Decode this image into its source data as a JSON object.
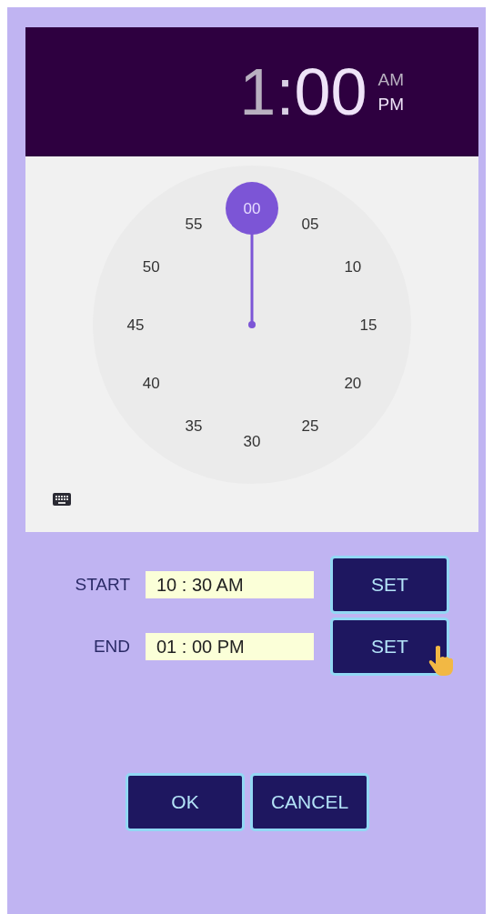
{
  "header": {
    "hour": {
      "text": "1",
      "selected": false
    },
    "separator": ":",
    "minute": {
      "text": "00",
      "selected": true
    },
    "periods": [
      {
        "label": "AM",
        "selected": false
      },
      {
        "label": "PM",
        "selected": true
      }
    ]
  },
  "dial": {
    "numbers": [
      {
        "label": "00",
        "selected": true
      },
      {
        "label": "05",
        "selected": false
      },
      {
        "label": "10",
        "selected": false
      },
      {
        "label": "15",
        "selected": false
      },
      {
        "label": "20",
        "selected": false
      },
      {
        "label": "25",
        "selected": false
      },
      {
        "label": "30",
        "selected": false
      },
      {
        "label": "35",
        "selected": false
      },
      {
        "label": "40",
        "selected": false
      },
      {
        "label": "45",
        "selected": false
      },
      {
        "label": "50",
        "selected": false
      },
      {
        "label": "55",
        "selected": false
      }
    ]
  },
  "rows": [
    {
      "label": "START",
      "value": "10 : 30 AM",
      "button": "SET",
      "touched": false
    },
    {
      "label": "END",
      "value": "01 : 00 PM",
      "button": "SET",
      "touched": true
    }
  ],
  "buttons": [
    "OK",
    "CANCEL"
  ]
}
